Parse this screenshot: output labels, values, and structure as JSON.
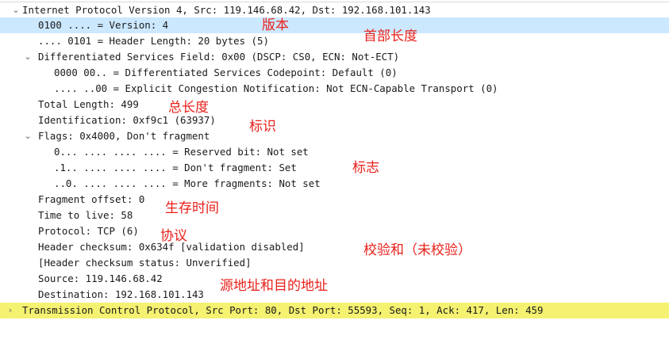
{
  "tree": {
    "ip_header": "Internet Protocol Version 4, Src: 119.146.68.42, Dst: 192.168.101.143",
    "version": "0100 .... = Version: 4",
    "header_length": ".... 0101 = Header Length: 20 bytes (5)",
    "dsfield": "Differentiated Services Field: 0x00 (DSCP: CS0, ECN: Not-ECT)",
    "dscp": "0000 00.. = Differentiated Services Codepoint: Default (0)",
    "ecn": ".... ..00 = Explicit Congestion Notification: Not ECN-Capable Transport (0)",
    "total_length": "Total Length: 499",
    "identification": "Identification: 0xf9c1 (63937)",
    "flags": "Flags: 0x4000, Don't fragment",
    "reserved_bit": "0... .... .... .... = Reserved bit: Not set",
    "dont_fragment": ".1.. .... .... .... = Don't fragment: Set",
    "more_fragments": "..0. .... .... .... = More fragments: Not set",
    "fragment_offset": "Fragment offset: 0",
    "ttl": "Time to live: 58",
    "protocol": "Protocol: TCP (6)",
    "checksum": "Header checksum: 0x634f [validation disabled]",
    "checksum_status": "[Header checksum status: Unverified]",
    "source": "Source: 119.146.68.42",
    "destination": "Destination: 192.168.101.143",
    "tcp_header": "Transmission Control Protocol, Src Port: 80, Dst Port: 55593, Seq: 1, Ack: 417, Len: 459"
  },
  "annotations": {
    "version": "版本",
    "header_length": "首部长度",
    "total_length": "总长度",
    "identification": "标识",
    "flags": "标志",
    "ttl": "生存时间",
    "protocol": "协议",
    "checksum": "校验和（未校验）",
    "addresses": "源地址和目的地址"
  },
  "icons": {
    "expanded": "chevron-down-icon",
    "collapsed": "chevron-right-icon"
  },
  "colors": {
    "selected_row": "#cce8ff",
    "highlight_row": "#f5f171",
    "annotation": "#e8201a"
  }
}
